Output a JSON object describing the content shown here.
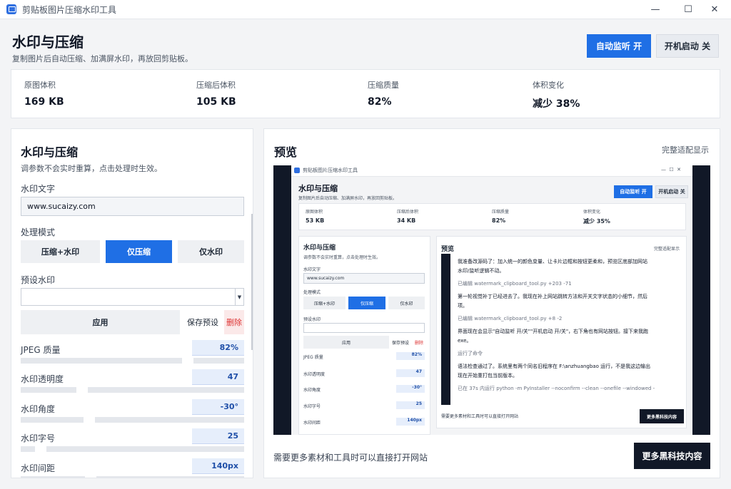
{
  "window": {
    "title": "剪贴板图片压缩水印工具",
    "minimize": "—",
    "maximize": "☐",
    "close": "✕"
  },
  "header": {
    "title": "水印与压缩",
    "subtitle": "复制图片后自动压缩、加满屏水印，再放回剪贴板。",
    "auto_monitor": "自动监听  开",
    "startup": "开机启动  关"
  },
  "stats": [
    {
      "label": "原图体积",
      "value": "169 KB"
    },
    {
      "label": "压缩后体积",
      "value": "105 KB"
    },
    {
      "label": "压缩质量",
      "value": "82%"
    },
    {
      "label": "体积变化",
      "value": "减少 38%"
    }
  ],
  "left": {
    "title": "水印与压缩",
    "subtitle": "调参数不会实时重算，点击处理时生效。",
    "watermark_label": "水印文字",
    "watermark_value": "www.sucaizy.com",
    "mode_label": "处理模式",
    "modes": [
      "压缩+水印",
      "仅压缩",
      "仅水印"
    ],
    "active_mode": "仅压缩",
    "preset_label": "预设水印",
    "apply": "应用",
    "save_preset": "保存预设",
    "delete": "删除",
    "params": [
      {
        "label": "JPEG 质量",
        "value": "82%"
      },
      {
        "label": "水印透明度",
        "value": "47"
      },
      {
        "label": "水印角度",
        "value": "-30°"
      },
      {
        "label": "水印字号",
        "value": "25"
      },
      {
        "label": "水印间距",
        "value": "140px"
      }
    ]
  },
  "right": {
    "title": "预览",
    "fit_link": "完整适配显示",
    "footer_text": "需要更多素材和工具时可以直接打开网站",
    "more_button": "更多黑科技内容"
  },
  "mini": {
    "window_title": "剪贴板图片压缩水印工具",
    "title": "水印与压缩",
    "subtitle": "复制图片后自动压缩、加满屏水印，再放回剪贴板。",
    "auto_monitor": "自动监听  开",
    "startup": "开机启动  关",
    "stats": [
      {
        "label": "原图体积",
        "value": "53 KB"
      },
      {
        "label": "压缩后体积",
        "value": "34 KB"
      },
      {
        "label": "压缩质量",
        "value": "82%"
      },
      {
        "label": "体积变化",
        "value": "减少 35%"
      }
    ],
    "left_title": "水印与压缩",
    "left_sub": "调参数不会实时重算，点击处理时生效。",
    "wm_label": "水印文字",
    "wm_value": "www.sucaizy.com",
    "mode_label": "处理模式",
    "modes": [
      "压缩+水印",
      "仅压缩",
      "仅水印"
    ],
    "preset_label": "预设水印",
    "apply": "应用",
    "save": "保存预设",
    "del": "删除",
    "params": [
      {
        "label": "JPEG 质量",
        "value": "82%"
      },
      {
        "label": "水印透明度",
        "value": "47"
      },
      {
        "label": "水印角度",
        "value": "-30°"
      },
      {
        "label": "水印字号",
        "value": "25"
      },
      {
        "label": "水印间距",
        "value": "140px"
      }
    ],
    "preview_title": "预览",
    "fit_link": "完整适配显示",
    "chat": [
      "我准备改源码了：加入统一的颜色变量、让卡片边框和按钮更柔和，预览区底部加网站",
      "水印/监听逻辑不动。",
      "已编辑 watermark_clipboard_tool.py +203 -71",
      "第一轮视觉补丁已经进去了。我现在补上网站跳转方法和开关文字状态的小细节，然后",
      "项。",
      "已编辑 watermark_clipboard_tool.py +8 -2",
      "界面现在会显示\"自动监听 开/关\"\"开机启动 开/关\"，右下角也有网站按钮。接下来我跑",
      "exe。",
      "运行了命令",
      "语法检查通过了。系统里有两个同名旧程序在 F:\\anzhuangbao 运行，不是我这边输出",
      "现在开始重打包当前版本。",
      "已在 37s 内运行 python -m PyInstaller --noconfirm --clean --onefile --windowed -"
    ],
    "footer_text": "需要更多素材和工具时可以直接打开网站",
    "more_button": "更多黑科技内容"
  }
}
